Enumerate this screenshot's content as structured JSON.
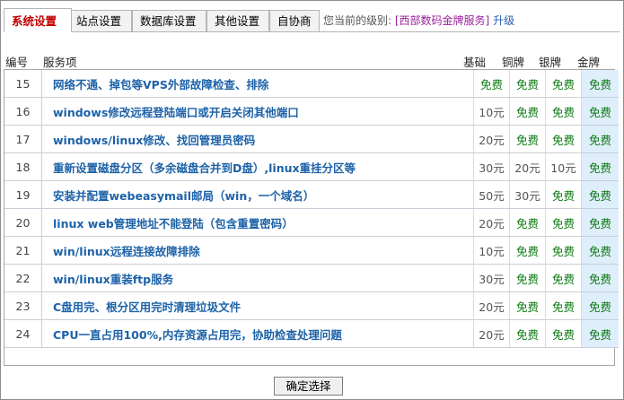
{
  "tabs": [
    {
      "label": "系统设置",
      "active": true
    },
    {
      "label": "站点设置",
      "active": false
    },
    {
      "label": "数据库设置",
      "active": false
    },
    {
      "label": "其他设置",
      "active": false
    },
    {
      "label": "自协商",
      "active": false
    }
  ],
  "level_info": {
    "prefix": "您当前的级别:",
    "level": "[西部数码金牌服务]",
    "upgrade": "升级"
  },
  "columns": {
    "no": "编号",
    "service": "服务项",
    "basic": "基础",
    "bronze": "铜牌",
    "silver": "银牌",
    "gold": "金牌"
  },
  "rows": [
    {
      "no": "15",
      "desc": "网络不通、掉包等VPS外部故障检查、排除",
      "basic": "免费",
      "bronze": "免费",
      "silver": "免费",
      "gold": "免费"
    },
    {
      "no": "16",
      "desc": "windows修改远程登陆端口或开启关闭其他端口",
      "basic": "10元",
      "bronze": "免费",
      "silver": "免费",
      "gold": "免费"
    },
    {
      "no": "17",
      "desc": "windows/linux修改、找回管理员密码",
      "basic": "20元",
      "bronze": "免费",
      "silver": "免费",
      "gold": "免费"
    },
    {
      "no": "18",
      "desc": "重新设置磁盘分区（多余磁盘合并到D盘）,linux重挂分区等",
      "basic": "30元",
      "bronze": "20元",
      "silver": "10元",
      "gold": "免费"
    },
    {
      "no": "19",
      "desc": "安装并配置webeasymail邮局（win，一个域名）",
      "basic": "50元",
      "bronze": "30元",
      "silver": "免费",
      "gold": "免费"
    },
    {
      "no": "20",
      "desc": "linux web管理地址不能登陆（包含重置密码）",
      "basic": "20元",
      "bronze": "免费",
      "silver": "免费",
      "gold": "免费"
    },
    {
      "no": "21",
      "desc": "win/linux远程连接故障排除",
      "basic": "10元",
      "bronze": "免费",
      "silver": "免费",
      "gold": "免费"
    },
    {
      "no": "22",
      "desc": "win/linux重装ftp服务",
      "basic": "30元",
      "bronze": "免费",
      "silver": "免费",
      "gold": "免费"
    },
    {
      "no": "23",
      "desc": "C盘用完、根分区用完时清理垃圾文件",
      "basic": "20元",
      "bronze": "免费",
      "silver": "免费",
      "gold": "免费"
    },
    {
      "no": "24",
      "desc": "CPU一直占用100%,内存资源占用完，协助检查处理问题",
      "basic": "20元",
      "bronze": "免费",
      "silver": "免费",
      "gold": "免费"
    }
  ],
  "free_label": "免费",
  "confirm_label": "确定选择",
  "colors": {
    "active_tab": "#c00000",
    "link": "#1d62a8",
    "free": "#0c7a13",
    "gold_column": "#dfeefb"
  }
}
